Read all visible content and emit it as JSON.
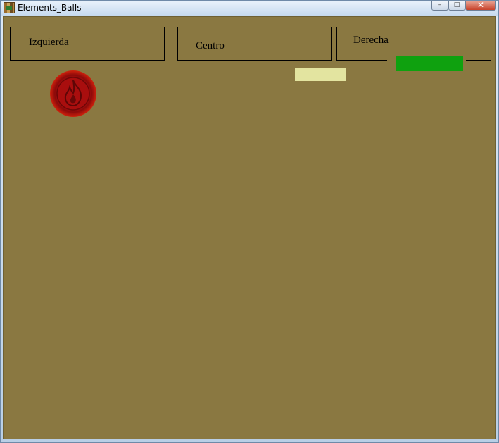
{
  "window": {
    "title": "Elements_Balls",
    "controls": {
      "minimize": "–",
      "maximize": "□",
      "close": "✕"
    }
  },
  "zones": {
    "left": "Izquierda",
    "center": "Centro",
    "right": "Derecha"
  },
  "colors": {
    "background": "#8a7841",
    "paddle_yellow": "#e3e4a0",
    "paddle_green": "#0fa10f",
    "ball": "#a90e0e"
  },
  "ball": {
    "element": "fire",
    "icon": "flame-icon"
  }
}
